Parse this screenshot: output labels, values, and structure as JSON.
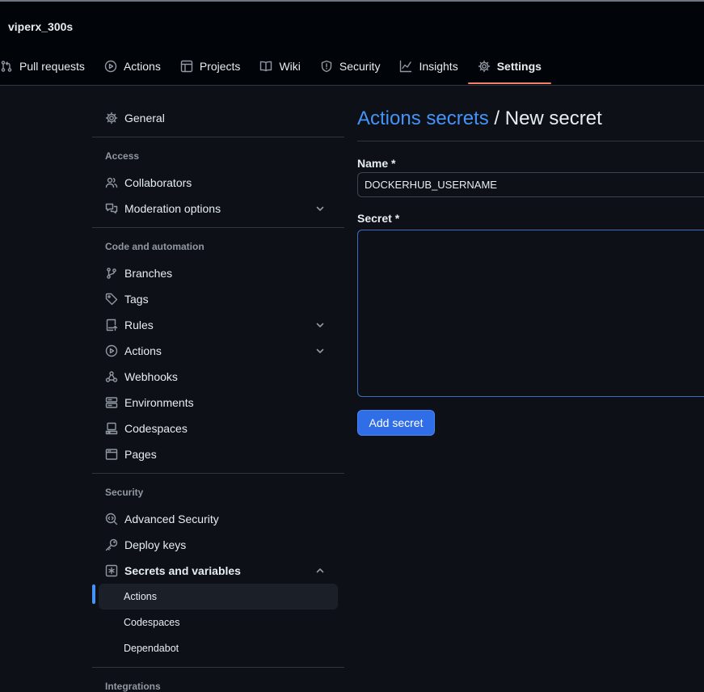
{
  "repo": {
    "name": "viperx_300s"
  },
  "tabs": [
    {
      "label": "Pull requests",
      "icon": "pull-request-icon"
    },
    {
      "label": "Actions",
      "icon": "play-icon"
    },
    {
      "label": "Projects",
      "icon": "table-icon"
    },
    {
      "label": "Wiki",
      "icon": "book-icon"
    },
    {
      "label": "Security",
      "icon": "shield-icon"
    },
    {
      "label": "Insights",
      "icon": "graph-icon"
    },
    {
      "label": "Settings",
      "icon": "gear-icon",
      "active": true
    }
  ],
  "sidebar": {
    "general": "General",
    "access": {
      "heading": "Access",
      "items": [
        "Collaborators",
        "Moderation options"
      ]
    },
    "code": {
      "heading": "Code and automation",
      "items": [
        "Branches",
        "Tags",
        "Rules",
        "Actions",
        "Webhooks",
        "Environments",
        "Codespaces",
        "Pages"
      ]
    },
    "security": {
      "heading": "Security",
      "items": [
        "Advanced Security",
        "Deploy keys",
        "Secrets and variables"
      ],
      "sub_items": [
        "Actions",
        "Codespaces",
        "Dependabot"
      ],
      "selected_sub": "Actions"
    },
    "next_heading": "Integrations"
  },
  "main": {
    "breadcrumb_link": "Actions secrets",
    "separator": " / ",
    "title": "New secret",
    "name_label": "Name *",
    "name_value": "DOCKERHUB_USERNAME",
    "secret_label": "Secret *",
    "secret_value": "",
    "submit_label": "Add secret"
  },
  "colors": {
    "background": "#0d1117",
    "header": "#010409",
    "link": "#4493f8",
    "active_tab_underline": "#f78166",
    "primary_button": "#2f6ee6",
    "selected_indicator": "#4493f8"
  }
}
